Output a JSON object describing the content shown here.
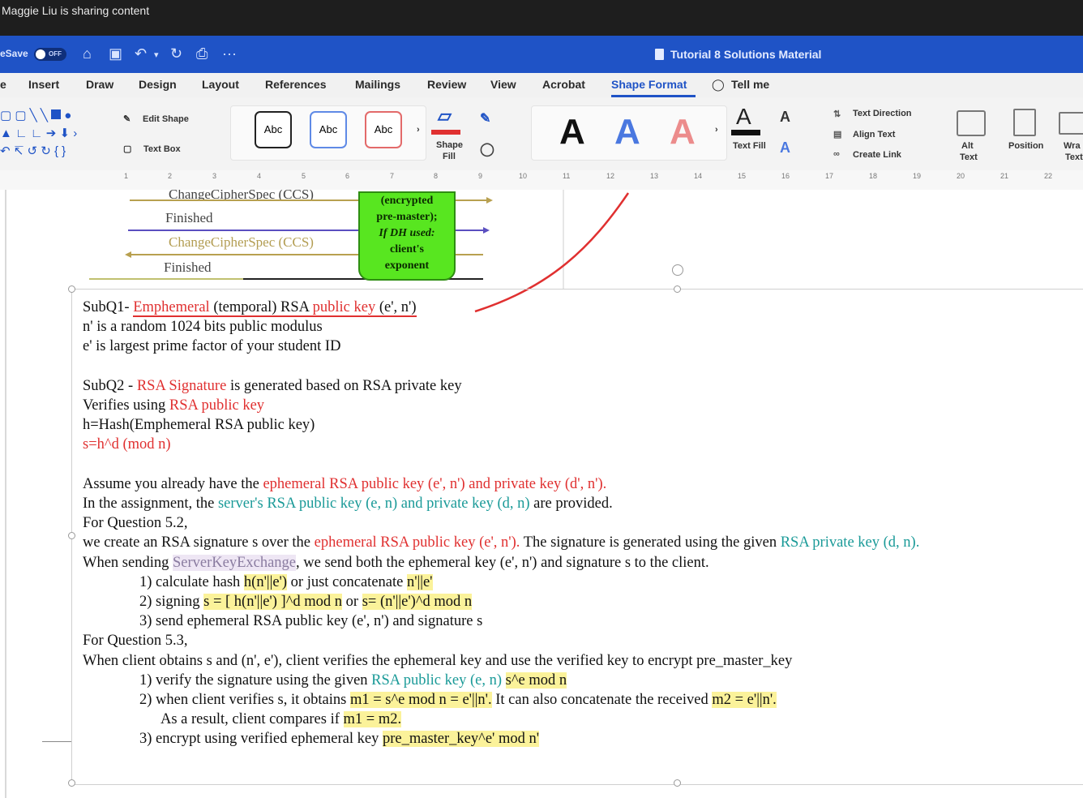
{
  "share_bar": {
    "text": "Maggie Liu is sharing content"
  },
  "titlebar": {
    "autosave_label": "eSave",
    "autosave_state": "OFF",
    "doc_title": "Tutorial 8 Solutions Material",
    "more": "···"
  },
  "menu": {
    "tabs": [
      "e",
      "Insert",
      "Draw",
      "Design",
      "Layout",
      "References",
      "Mailings",
      "Review",
      "View",
      "Acrobat",
      "Shape Format",
      "Tell me"
    ],
    "active_tab": "Shape Format"
  },
  "ribbon": {
    "edit_shape": "Edit Shape",
    "text_box": "Text Box",
    "abc": "Abc",
    "shape_fill_1": "Shape",
    "shape_fill_2": "Fill",
    "text_fill": "Text Fill",
    "text_direction": "Text Direction",
    "align_text": "Align Text",
    "create_link": "Create Link",
    "alt_text_1": "Alt",
    "alt_text_2": "Text",
    "position": "Position",
    "wrap_1": "Wra",
    "wrap_2": "Text"
  },
  "ruler": {
    "ticks": [
      "1",
      "2",
      "3",
      "4",
      "5",
      "6",
      "7",
      "8",
      "9",
      "10",
      "11",
      "12",
      "13",
      "14",
      "15",
      "16",
      "17",
      "18",
      "19",
      "20",
      "21",
      "22"
    ]
  },
  "diagram": {
    "ccs_top": "ChangeCipherSpec (CCS)",
    "finished_1": "Finished",
    "ccs": "ChangeCipherSpec (CCS)",
    "finished_2": "Finished",
    "green_box": [
      "(encrypted",
      "pre-master);",
      "If DH used:",
      "client's",
      "exponent"
    ]
  },
  "content": {
    "subq1_a": "SubQ1- ",
    "subq1_b": "Emphemeral",
    "subq1_c": " (temporal) RSA ",
    "subq1_d": "public key",
    "subq1_e": " (e', n')",
    "l2": "n' is a random 1024 bits public modulus",
    "l3": "e' is largest prime factor of your student ID",
    "subq2_a": "SubQ2 - ",
    "subq2_b": "RSA Signature",
    "subq2_c": " is generated based on RSA private key",
    "ver_a": "Verifies using ",
    "ver_b": "RSA public key",
    "hash": "h=Hash(Emphemeral RSA public key)",
    "sig": "s=h^d (mod n)",
    "assume_a": "Assume you already have the ",
    "assume_b": "ephemeral RSA public key (e', n') and private key (d', n').",
    "assign_a": "In the assignment, the ",
    "assign_b": "server's RSA public key (e, n) and private key (d, n)",
    "assign_c": " are provided.",
    "q52": "For Question 5.2,",
    "create_a": "we create an RSA signature s over the ",
    "create_b": "ephemeral RSA public key (e', n').",
    "create_c": " The signature is generated using the given ",
    "create_d": "RSA private key (d, n).",
    "send_a": "When sending ",
    "send_b": "ServerKeyExchange",
    "send_c": ", we send both the ephemeral key (e', n') and signature s to the client.",
    "s1_a": "1) calculate hash ",
    "s1_b": "h(n'||e')",
    "s1_c": " or just concatenate ",
    "s1_d": "n'||e'",
    "s2_a": "2) signing ",
    "s2_b": "s = [ h(n'||e') ]^d mod n",
    "s2_c": "  or  ",
    "s2_d": "s= (n'||e')^d mod n",
    "s3": "3) send ephemeral RSA public key (e', n') and signature s",
    "q53": "For Question 5.3,",
    "client": "When client obtains s and (n', e'), client verifies the ephemeral key and use the verified key to encrypt pre_master_key",
    "v1_a": "1) verify the signature using the given ",
    "v1_b": "RSA public key (e, n)",
    "v1_c": "   ",
    "v1_d": "s^e mod n",
    "v2_a": "2) when client verifies s, it obtains ",
    "v2_b": "m1 = s^e mod n = e'||n'.",
    "v2_c": " It can also concatenate the received ",
    "v2_d": "m2 = e'||n'.",
    "v2e_a": "As a result, client compares if ",
    "v2e_b": "m1 = m2.",
    "v3_a": "3) encrypt using verified ephemeral key    ",
    "v3_b": "pre_master_key^e' mod n'"
  },
  "colors": {
    "accent": "#1f53c6",
    "red": "#e03030",
    "teal": "#1a9a98",
    "highlight": "#fbf29a",
    "green": "#58e620"
  },
  "icons": [
    "home-icon",
    "save-icon",
    "undo-icon",
    "redo-icon",
    "print-icon",
    "document-icon",
    "lightbulb-icon"
  ]
}
